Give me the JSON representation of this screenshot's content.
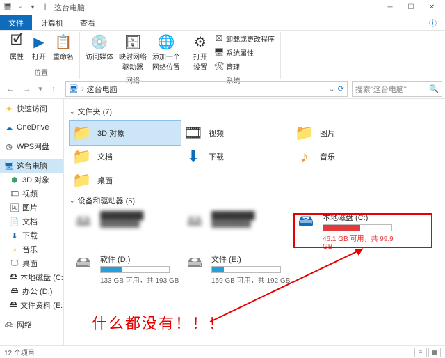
{
  "window": {
    "title": "这台电脑",
    "min": "─",
    "max": "☐",
    "close": "✕"
  },
  "tabs": {
    "file": "文件",
    "computer": "计算机",
    "view": "查看"
  },
  "ribbon": {
    "position_group": "位置",
    "network_group": "网络",
    "system_group": "系统",
    "properties": "属性",
    "open": "打开",
    "rename": "重命名",
    "access_media": "访问媒体",
    "map_drive": "映射网络\n驱动器",
    "add_location": "添加一个\n网络位置",
    "open_settings": "打开\n设置",
    "uninstall": "卸载或更改程序",
    "sys_props": "系统属性",
    "manage": "管理"
  },
  "address": {
    "location": "这台电脑",
    "refresh": "⟳"
  },
  "search": {
    "placeholder": "搜索\"这台电脑\""
  },
  "sidebar": {
    "quick": "快速访问",
    "onedrive": "OneDrive",
    "wps": "WPS网盘",
    "thispc": "这台电脑",
    "items": [
      "3D 对象",
      "视频",
      "图片",
      "文档",
      "下载",
      "音乐",
      "桌面",
      "本地磁盘 (C:)",
      "办公 (D:)",
      "文件资料 (E:)"
    ],
    "network": "网络"
  },
  "sections": {
    "folders": "文件夹 (7)",
    "devices": "设备和驱动器 (5)"
  },
  "folders": [
    "3D 对象",
    "视频",
    "图片",
    "文档",
    "下载",
    "音乐",
    "桌面"
  ],
  "drives": {
    "c": {
      "name": "本地磁盘 (C:)",
      "sub": "46.1 GB 可用，共 99.9 GB"
    },
    "d": {
      "name": "软件 (D:)",
      "sub": "133 GB 可用，共 193 GB"
    },
    "e": {
      "name": "文件 (E:)",
      "sub": "159 GB 可用，共 192 GB"
    }
  },
  "annotation": "什么都没有！！！",
  "status": {
    "count": "12 个项目"
  }
}
